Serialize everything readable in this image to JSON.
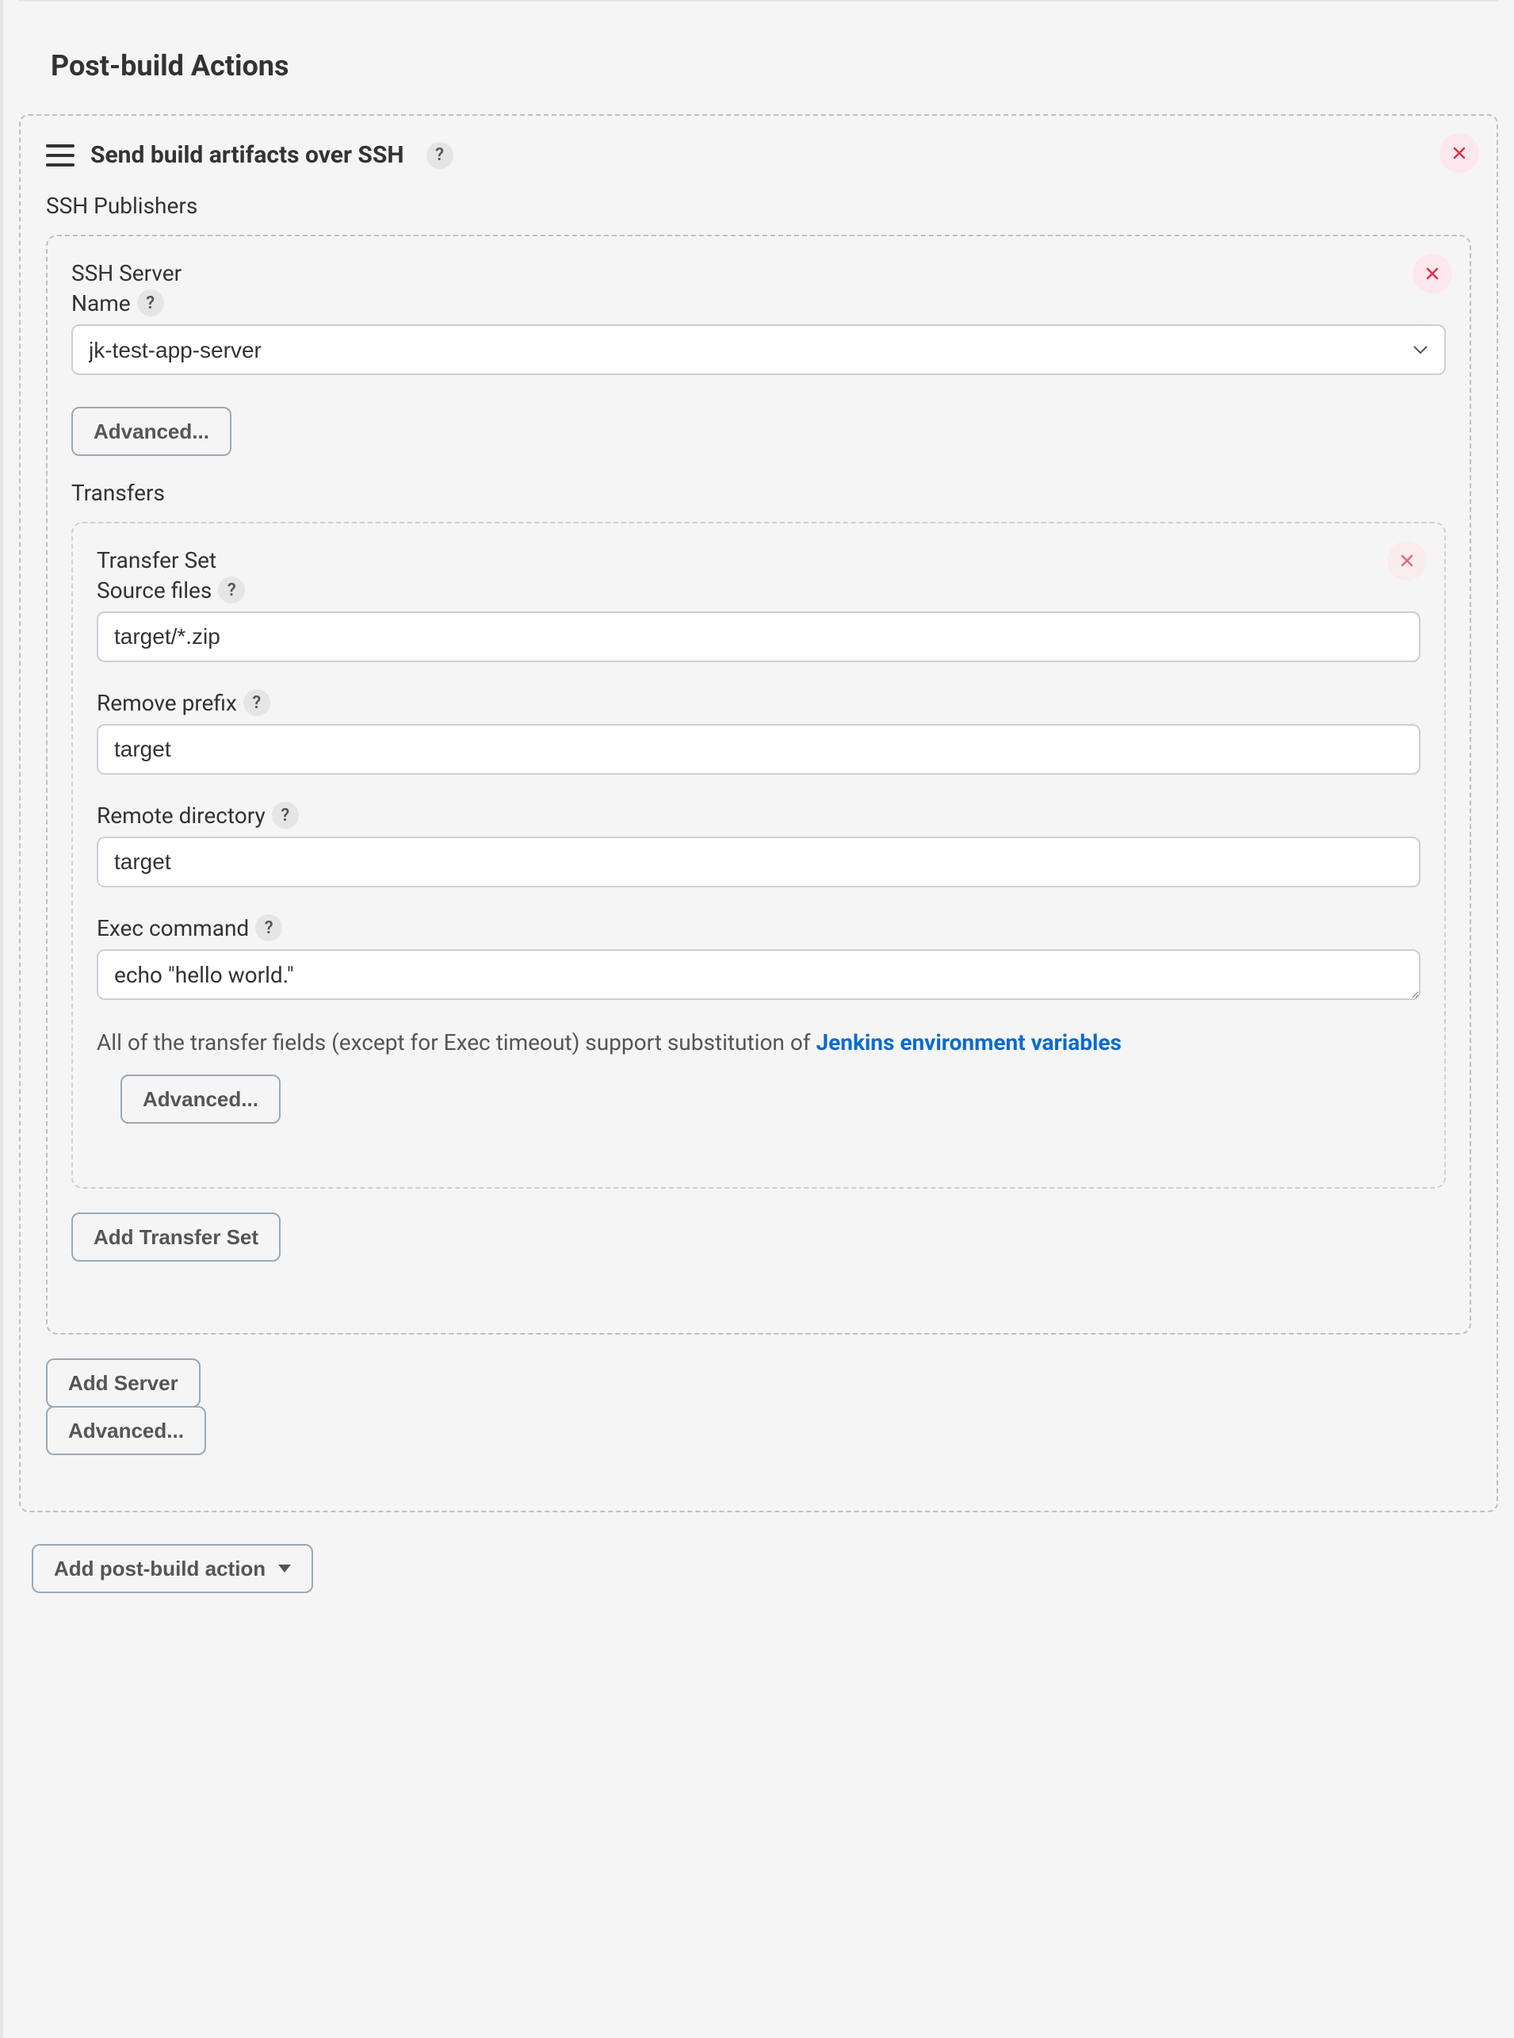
{
  "section": {
    "title": "Post-build Actions"
  },
  "action": {
    "title": "Send build artifacts over SSH",
    "publishers_label": "SSH Publishers"
  },
  "ssh_server": {
    "heading": "SSH Server",
    "name_label": "Name",
    "selected": "jk-test-app-server",
    "advanced_btn": "Advanced...",
    "transfers_label": "Transfers"
  },
  "transfer_set": {
    "heading": "Transfer Set",
    "source_files_label": "Source files",
    "source_files_value": "target/*.zip",
    "remove_prefix_label": "Remove prefix",
    "remove_prefix_value": "target",
    "remote_dir_label": "Remote directory",
    "remote_dir_value": "target",
    "exec_cmd_label": "Exec command",
    "exec_cmd_value": "echo \"hello world.\"",
    "hint_text": "All of the transfer fields (except for Exec timeout) support substitution of ",
    "hint_link": "Jenkins environment variables",
    "advanced_btn": "Advanced..."
  },
  "buttons": {
    "add_transfer_set": "Add Transfer Set",
    "add_server": "Add Server",
    "advanced": "Advanced...",
    "add_post_build": "Add post-build action"
  }
}
